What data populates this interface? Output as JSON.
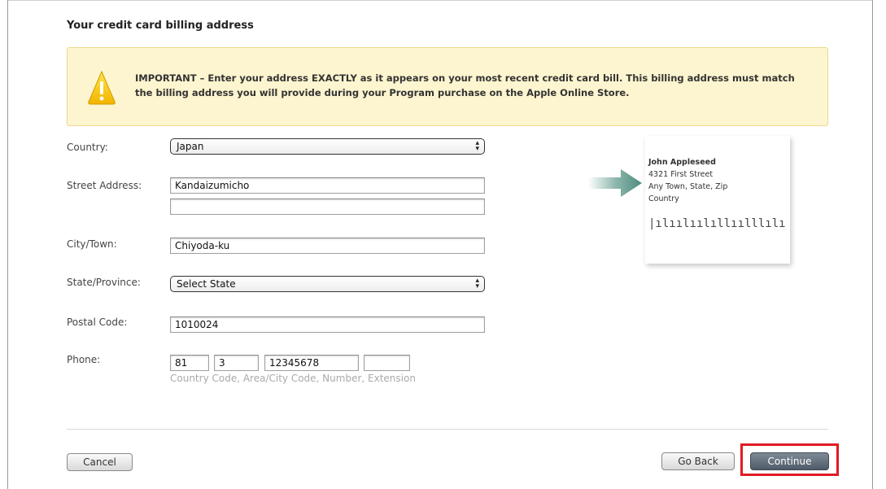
{
  "section_title": "Your credit card billing address",
  "notice": {
    "text": "IMPORTANT – Enter your address EXACTLY as it appears on your most recent credit card bill. This billing address must match the billing address you will provide during your Program purchase on the Apple Online Store.",
    "icon": "warning-icon",
    "background_color": "#fdf5cf"
  },
  "form": {
    "country": {
      "label": "Country:",
      "value": "Japan"
    },
    "street": {
      "label": "Street Address:",
      "line1": "Kandaizumicho",
      "line2": ""
    },
    "city": {
      "label": "City/Town:",
      "value": "Chiyoda-ku"
    },
    "state": {
      "label": "State/Province:",
      "value": "Select State"
    },
    "postal": {
      "label": "Postal Code:",
      "value": "1010024"
    },
    "phone": {
      "label": "Phone:",
      "country_code": "81",
      "area_code": "3",
      "number": "12345678",
      "extension": "",
      "hint": "Country Code, Area/City Code, Number, Extension"
    }
  },
  "sample_address": {
    "name": "John Appleseed",
    "street": "4321 First Street",
    "city_line": "Any Town, State, Zip",
    "country": "Country",
    "barcode": "|ılıılıılıllıılllılı"
  },
  "buttons": {
    "cancel": "Cancel",
    "go_back": "Go Back",
    "continue": "Continue"
  },
  "colors": {
    "highlight": "#e01b24",
    "primary_button": "#5f6b78"
  }
}
